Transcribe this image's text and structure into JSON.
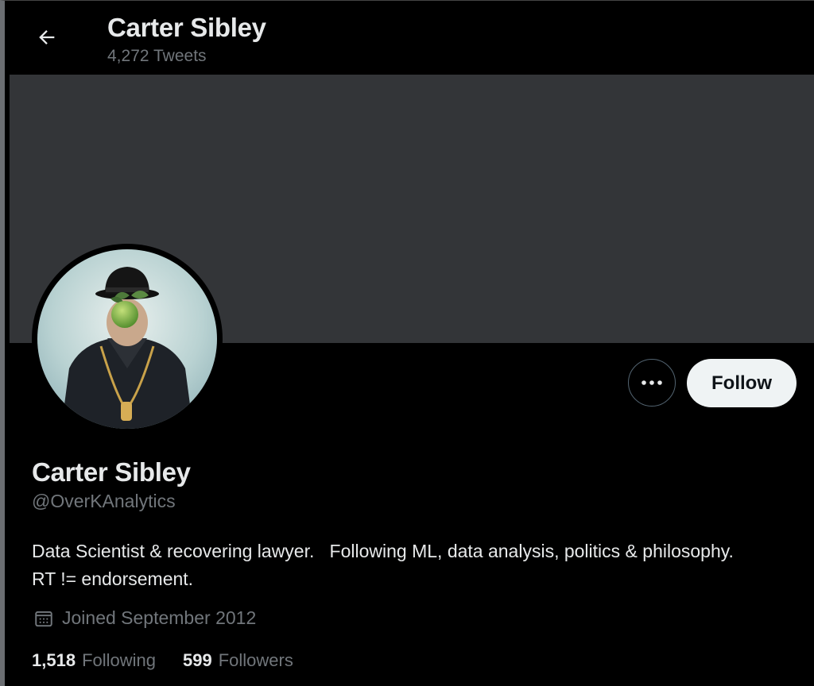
{
  "header": {
    "name": "Carter Sibley",
    "tweet_count": "4,272 Tweets"
  },
  "profile": {
    "name": "Carter Sibley",
    "handle": "@OverKAnalytics",
    "bio": "Data Scientist & recovering lawyer.   Following ML, data analysis, politics & philosophy.  RT != endorsement.",
    "joined": "Joined September 2012",
    "following_count": "1,518",
    "following_label": "Following",
    "followers_count": "599",
    "followers_label": "Followers"
  },
  "actions": {
    "follow_label": "Follow",
    "more_icon": "more-horizontal-icon",
    "back_icon": "arrow-left-icon"
  },
  "colors": {
    "background": "#000000",
    "banner": "#333538",
    "text_primary": "#e7e9ea",
    "text_secondary": "#71767b",
    "follow_button_bg": "#eff3f4"
  }
}
